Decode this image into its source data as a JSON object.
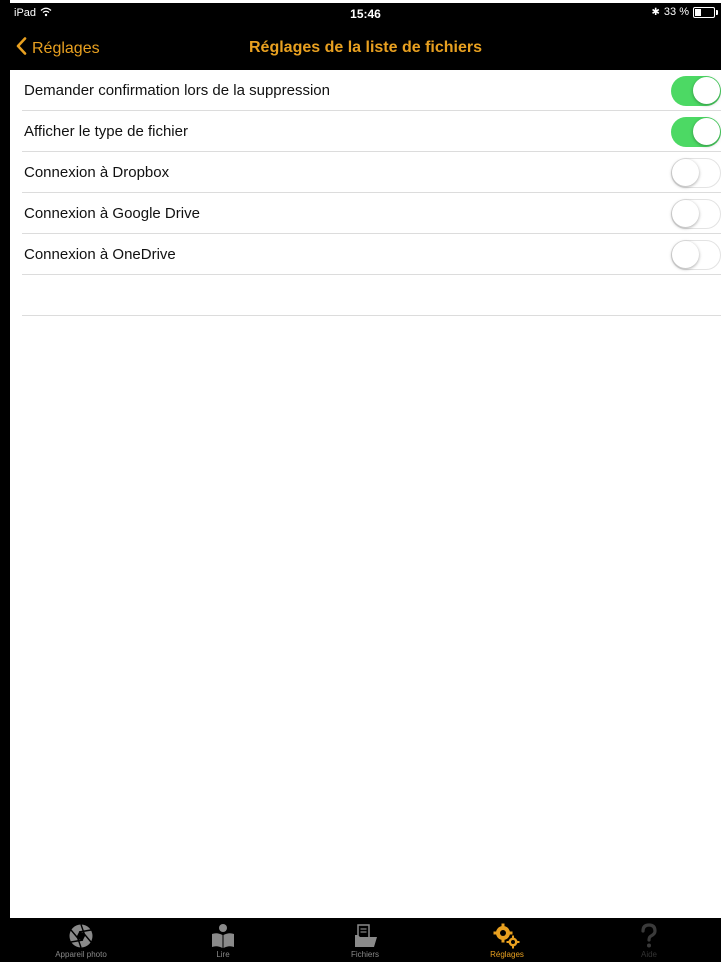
{
  "status_bar": {
    "carrier": "iPad",
    "time": "15:46",
    "bluetooth": "✱",
    "battery_text": "33 %",
    "battery_level": 0.33
  },
  "nav": {
    "back_label": "Réglages",
    "title": "Réglages de la liste de fichiers"
  },
  "settings": [
    {
      "label": "Demander confirmation lors de la suppression",
      "on": true
    },
    {
      "label": "Afficher le type de fichier",
      "on": true
    },
    {
      "label": "Connexion à Dropbox",
      "on": false
    },
    {
      "label": "Connexion à Google Drive",
      "on": false
    },
    {
      "label": "Connexion à OneDrive",
      "on": false
    }
  ],
  "tabs": [
    {
      "label": "Appareil photo",
      "icon": "camera-aperture-icon",
      "active": false
    },
    {
      "label": "Lire",
      "icon": "reader-icon",
      "active": false
    },
    {
      "label": "Fichiers",
      "icon": "files-icon",
      "active": false
    },
    {
      "label": "Réglages",
      "icon": "gears-icon",
      "active": true
    },
    {
      "label": "Aide",
      "icon": "question-icon",
      "active": false
    }
  ],
  "colors": {
    "accent": "#e8a020",
    "toggle_on": "#4cd964",
    "bar_background": "#000000",
    "inactive_tab": "#8a8a8a"
  }
}
